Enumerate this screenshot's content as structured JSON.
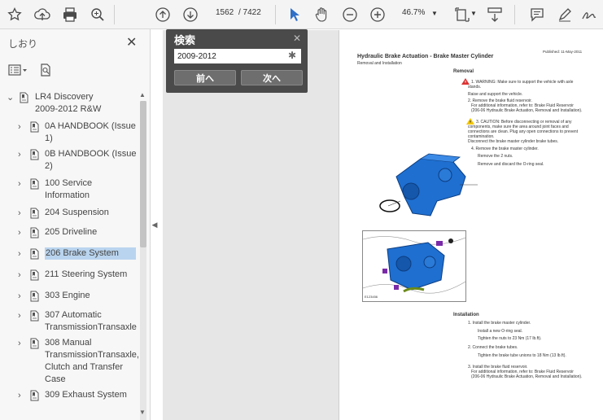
{
  "toolbar": {
    "page_current": "1562",
    "page_total": "/ 7422",
    "zoom": "46.7%"
  },
  "panel": {
    "title": "しおり",
    "items": [
      {
        "label": [
          "LR4 Discovery",
          "2009-2012  R&W"
        ],
        "expanded": true
      },
      {
        "label": [
          "0A HANDBOOK (Issue",
          "1)"
        ]
      },
      {
        "label": [
          "0B HANDBOOK (Issue",
          "2)"
        ]
      },
      {
        "label": [
          "100 Service",
          "Information"
        ]
      },
      {
        "label": [
          "204 Suspension"
        ]
      },
      {
        "label": [
          "205 Driveline"
        ]
      },
      {
        "label": [
          "206 Brake System"
        ],
        "selected": true
      },
      {
        "label": [
          "211 Steering System"
        ]
      },
      {
        "label": [
          "303 Engine"
        ]
      },
      {
        "label": [
          "307 Automatic",
          "TransmissionTransaxle"
        ]
      },
      {
        "label": [
          "308 Manual",
          "TransmissionTransaxle,",
          "Clutch and Transfer",
          "Case"
        ]
      },
      {
        "label": [
          "309 Exhaust System"
        ]
      }
    ]
  },
  "search": {
    "title": "検索",
    "query": "2009-2012",
    "prev_label": "前へ",
    "next_label": "次へ"
  },
  "document": {
    "published": "Published: 11-May-2011",
    "title": "Hydraulic Brake Actuation - Brake Master Cylinder",
    "subtitle": "Removal and Installation",
    "removal_heading": "Removal",
    "installation_heading": "Installation",
    "removal_lines": [
      "1.  WARNING: Make sure to support the vehicle with axle",
      "stands.",
      "Raise and support the vehicle.",
      "2. Remove the brake fluid reservoir.",
      "For additional information, refer to: Brake Fluid Reservoir",
      "(206-06 Hydraulic Brake Actuation, Removal and Installation).",
      "3.  CAUTION: Before disconnecting or removal of any",
      "components, make sure the area around joint faces and",
      "connections are clean. Plug any open connections to prevent",
      "contamination.",
      "Disconnect the brake master cylinder brake tubes.",
      "4. Remove the brake master cylinder.",
      "Remove the 2 nuts.",
      "Remove and discard the O-ring seal."
    ],
    "installation_lines": [
      "1. Install the brake master cylinder.",
      "Install a new O-ring seal.",
      "Tighten the nuts to 23 Nm (17 lb.ft).",
      "2. Connect the brake tubes.",
      "Tighten the brake tube unions to 18 Nm (13 lb.ft).",
      "3. Install the brake fluid reservoir.",
      "For additional information, refer to: Brake Fluid Reservoir",
      "(206-06 Hydraulic Brake Actuation, Removal and Installation)."
    ],
    "figure_label": "E123456"
  }
}
